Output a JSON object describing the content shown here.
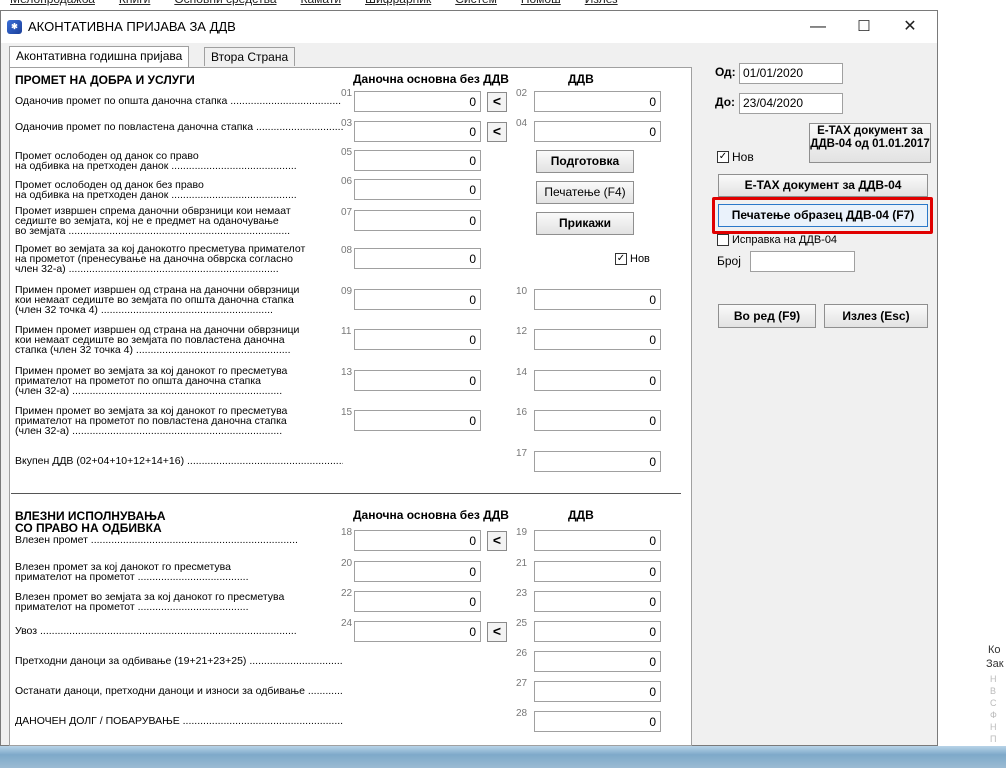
{
  "background_menu": [
    "Мелопродажба",
    "Книги",
    "Основни средства",
    "Камати",
    "Шифрарник",
    "Систем",
    "Помош",
    "Излез"
  ],
  "window": {
    "icon_name": "app-logo-icon",
    "title": "АКОНТАТИВНА ПРИЈАВА ЗА ДДВ",
    "minimize": "—",
    "maximize": "☐",
    "close": "✕"
  },
  "tabs": [
    "Аконтативна годишна пријава",
    "Втора Страна"
  ],
  "sections": {
    "promet": "ПРОМЕТ НА ДОБРА И УСЛУГИ",
    "vlezni_line1": "ВЛЕЗНИ ИСПОЛНУВАЊА",
    "vlezni_line2": "СО ПРАВО НА ОДБИВКА"
  },
  "columns": {
    "base": "Даночна основна без ДДВ",
    "vat": "ДДВ"
  },
  "rows": [
    {
      "label": [
        "Оданочив промет по општа даночна стапка ......................................"
      ],
      "n1": "01",
      "v1": "0",
      "n2": "02",
      "v2": "0",
      "arrow": "<"
    },
    {
      "label": [
        "Оданочив промет по повластена даночна стапка ...............................",
        ""
      ],
      "n1": "03",
      "v1": "0",
      "n2": "04",
      "v2": "0",
      "arrow": "<"
    },
    {
      "label": [
        "Промет ослободен од данок со право",
        "на одбивка на претходен данок ..........................................."
      ],
      "n1": "05",
      "v1": "0"
    },
    {
      "label": [
        "Промет ослободен од данок без право",
        "на одбивка на претходен данок ..........................................."
      ],
      "n1": "06",
      "v1": "0"
    },
    {
      "label": [
        "Промет извршен спрема даночни обврзници кои немаат",
        "седиште во земјата, кој не е предмет на оданочување",
        "во земјата ............................................................................"
      ],
      "n1": "07",
      "v1": "0"
    },
    {
      "label": [
        "Промет во земјата за кој данокотго пресметува примателот",
        "на прометот (пренесување на даночна обврска согласно",
        "член 32-а) ........................................................................"
      ],
      "n1": "08",
      "v1": "0"
    },
    {
      "label": [
        "Примен промет извршен од страна на даночни обврзници",
        "кои немаат седиште во земјата по општа даночна стапка",
        "(член 32 точка 4) ..........................................................."
      ],
      "n1": "09",
      "v1": "0",
      "n2": "10",
      "v2": "0"
    },
    {
      "label": [
        "Примен промет извршен од страна на даночни обврзници",
        "кои немаат седиште во земјата по повластена даночна",
        "стапка (член 32 точка 4) ....................................................."
      ],
      "n1": "11",
      "v1": "0",
      "n2": "12",
      "v2": "0"
    },
    {
      "label": [
        "Примен промет во земјата за кој данокот го пресметува",
        "примателот на прометот по општа даночна стапка",
        "(член 32-а) ........................................................................"
      ],
      "n1": "13",
      "v1": "0",
      "n2": "14",
      "v2": "0"
    },
    {
      "label": [
        "Примен промет во земјата за кој данокот го пресметува",
        "примателот на прометот по повластена даночна стапка",
        "(член 32-а) ........................................................................"
      ],
      "n1": "15",
      "v1": "0",
      "n2": "16",
      "v2": "0"
    },
    {
      "label": [
        "Вкупен ДДВ (02+04+10+12+14+16) ..............................................................................."
      ],
      "n2": "17",
      "v2": "0"
    }
  ],
  "rows_in": [
    {
      "label": [
        "Влезен промет ......................................................................."
      ],
      "n1": "18",
      "v1": "0",
      "n2": "19",
      "v2": "0",
      "arrow": "<"
    },
    {
      "label": [
        "Влезен промет за кој данокот го пресметува",
        "примателот на прометот ......................................"
      ],
      "n1": "20",
      "v1": "0",
      "n2": "21",
      "v2": "0"
    },
    {
      "label": [
        "Влезен промет во земјата за кој данокот го пресметува",
        "примателот на прометот ......................................"
      ],
      "n1": "22",
      "v1": "0",
      "n2": "23",
      "v2": "0"
    },
    {
      "label": [
        "Увоз ........................................................................................"
      ],
      "n1": "24",
      "v1": "0",
      "n2": "25",
      "v2": "0",
      "arrow": "<"
    },
    {
      "label": [
        "Претходни даноци за одбивање (19+21+23+25) ............................................................."
      ],
      "n2": "26",
      "v2": "0"
    },
    {
      "label": [
        "Останати даноци, претходни даноци и износи за одбивање ................................................"
      ],
      "n2": "27",
      "v2": "0"
    },
    {
      "label": [
        "ДАНОЧЕН ДОЛГ / ПОБАРУВАЊЕ ......................................................................................"
      ],
      "n2": "28",
      "v2": "0"
    }
  ],
  "middle_buttons": {
    "prepare": "Подготовка",
    "print": "Печатење (F4)",
    "show": "Прикажи",
    "nov_label": "Нов",
    "nov_checked": true
  },
  "right": {
    "od_label": "Од:",
    "od_value": "01/01/2020",
    "do_label": "До:",
    "do_value": "23/04/2020",
    "etax_2017": "E-TAX документ за ДДВ-04 од 01.01.2017",
    "nov_label": "Нов",
    "nov_checked": true,
    "etax": "E-TAX документ за ДДВ-04",
    "print_form": "Печатење образец ДДВ-04 (F7)",
    "ispravka": "Исправка на ДДВ-04",
    "broj_label": "Број",
    "broj_value": "",
    "ok": "Во ред (F9)",
    "exit": "Излез (Esc)",
    "highlight_color": "#e00000"
  },
  "desktop_side": [
    "Ко",
    "Зак",
    "Н",
    "В",
    "С",
    "Ф",
    "Н",
    "П"
  ]
}
